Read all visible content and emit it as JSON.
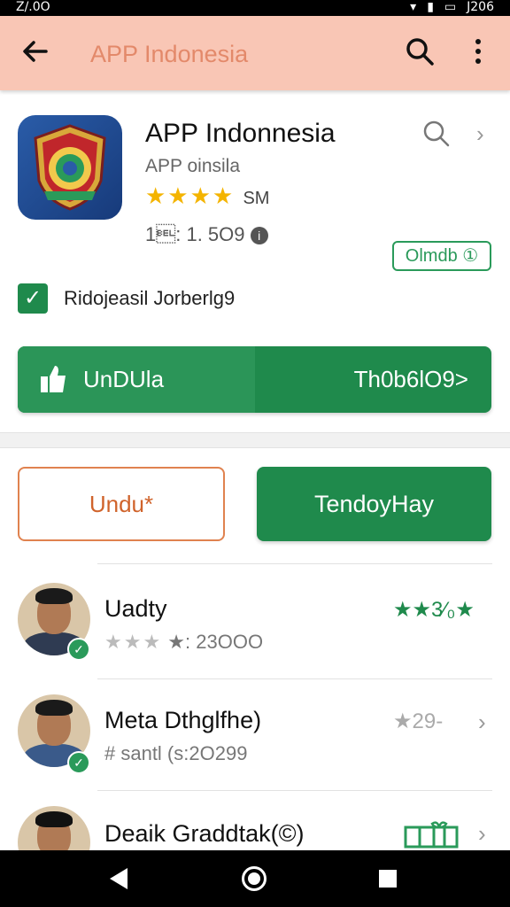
{
  "status_bar": {
    "time": "Z/.0O",
    "icons": [
      "image-icon",
      "wifi-icon",
      "signal-icon",
      "battery-icon"
    ],
    "battery_text": "J206"
  },
  "toolbar": {
    "title": "APP Indonesia",
    "back_icon": "arrow-left-icon",
    "search_icon": "search-icon",
    "more_icon": "more-vert-icon",
    "background": "#f9c6b5"
  },
  "app": {
    "name": "APP Indonnesia",
    "subtitle": "APP oinsila",
    "stars": "★★★★",
    "rating_count": "SM",
    "meta": "1\u0007: 1. 5O9",
    "badge": "Olmdb ①"
  },
  "checkbox": {
    "checked": true,
    "label": "Ridojeasil Jorberlg9"
  },
  "primary_button": {
    "left_label": "UnDUla",
    "right_label": "Th0b6lO9>"
  },
  "buttons": {
    "outline_label": "Undu*",
    "filled_label": "TendoyHay"
  },
  "colors": {
    "accent_green": "#1f8a4c",
    "orange": "#e0824f",
    "star": "#f4b400"
  },
  "reviews": [
    {
      "name": "Uadty",
      "sub_stars": "★★★",
      "sub_text": "★: 23OOO",
      "right_text": "★★3⁄₀★",
      "verified": true
    },
    {
      "name": "Meta Dthglfhe)",
      "sub_text": "# santl (s:2O299",
      "right_text": "★29-",
      "verified": true
    },
    {
      "name": "Deaik Graddtak(©)",
      "right_icon": "gift-icon"
    }
  ],
  "nav": {
    "back": "back-triangle-icon",
    "home": "home-circle-icon",
    "recents": "recents-square-icon"
  }
}
